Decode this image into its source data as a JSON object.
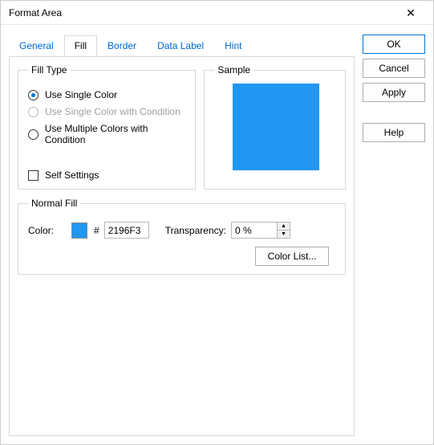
{
  "window": {
    "title": "Format Area"
  },
  "tabs": {
    "items": [
      {
        "label": "General"
      },
      {
        "label": "Fill"
      },
      {
        "label": "Border"
      },
      {
        "label": "Data Label"
      },
      {
        "label": "Hint"
      }
    ],
    "active": 1
  },
  "fillType": {
    "legend": "Fill Type",
    "opt_single": "Use Single Color",
    "opt_single_cond": "Use Single Color with Condition",
    "opt_multi_cond": "Use Multiple Colors with Condition",
    "self_settings": "Self Settings"
  },
  "sample": {
    "legend": "Sample",
    "color": "#2196F3"
  },
  "normalFill": {
    "legend": "Normal Fill",
    "colorLabel": "Color:",
    "hash": "#",
    "hex": "2196F3",
    "transparencyLabel": "Transparency:",
    "transparencyValue": "0 %",
    "colorListLabel": "Color List..."
  },
  "buttons": {
    "ok": "OK",
    "cancel": "Cancel",
    "apply": "Apply",
    "help": "Help"
  }
}
